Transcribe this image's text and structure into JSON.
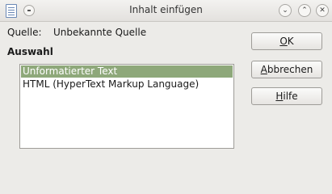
{
  "window": {
    "title": "Inhalt einfügen"
  },
  "source": {
    "label": "Quelle:",
    "value": "Unbekannte Quelle"
  },
  "selection": {
    "heading": "Auswahl",
    "items": [
      "Unformatierter Text",
      "HTML (HyperText Markup Language)"
    ],
    "selected_index": 0
  },
  "buttons": {
    "ok": {
      "accel": "O",
      "rest": "K"
    },
    "cancel": {
      "accel": "A",
      "rest": "bbrechen"
    },
    "help": {
      "accel": "H",
      "rest": "ilfe"
    }
  },
  "colors": {
    "selection": "#8ea87a",
    "background": "#ecebe8"
  }
}
